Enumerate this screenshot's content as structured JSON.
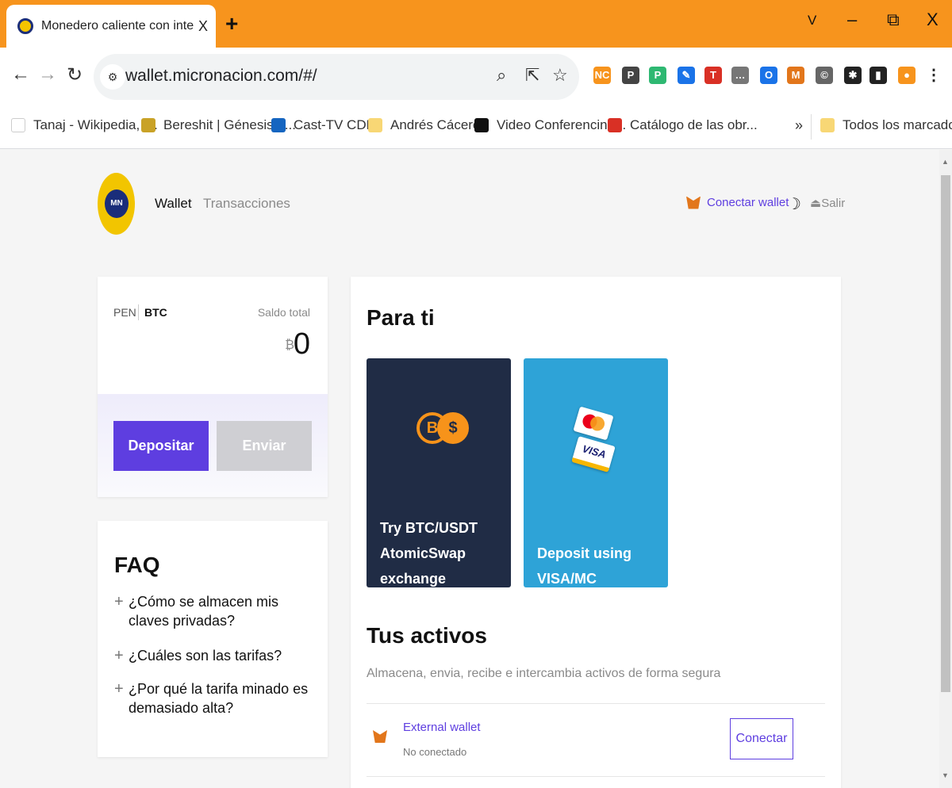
{
  "browser": {
    "tab_title": "Monedero caliente con intercam",
    "tab_close": "X",
    "new_tab": "+",
    "window_controls": {
      "menu": "V",
      "minimize": "–",
      "restore": "⧉",
      "close": "X"
    },
    "url": "wallet.micronacion.com/#/",
    "extensions": [
      {
        "icon": "nc-extension-icon",
        "label": "NC",
        "color": "#f7941d"
      },
      {
        "icon": "circle-p-extension-icon",
        "label": "P",
        "color": "#444444"
      },
      {
        "icon": "green-extension-icon",
        "label": "P",
        "color": "#2eb872"
      },
      {
        "icon": "feather-extension-icon",
        "label": "✎",
        "color": "#1a73e8"
      },
      {
        "icon": "t-extension-icon",
        "label": "T",
        "color": "#d93025"
      },
      {
        "icon": "comment-extension-icon",
        "label": "…",
        "color": "#777777"
      },
      {
        "icon": "blue-circle-extension-icon",
        "label": "O",
        "color": "#1a73e8"
      },
      {
        "icon": "metamask-extension-icon",
        "label": "M",
        "color": "#e2761b"
      },
      {
        "icon": "copyright-extension-icon",
        "label": "©",
        "color": "#666666"
      },
      {
        "icon": "puzzle-extension-icon",
        "label": "✱",
        "color": "#222222"
      },
      {
        "icon": "sidepanel-icon",
        "label": "▮",
        "color": "#222222"
      },
      {
        "icon": "profile-avatar-icon",
        "label": "●",
        "color": "#f7941d"
      },
      {
        "icon": "kebab-menu-icon",
        "label": "⋮",
        "color": "#ffffff"
      }
    ],
    "bookmarks": [
      {
        "label": "Tanaj - Wikipedia, l...",
        "icon_color": "#ffffff",
        "icon": "wikipedia-icon"
      },
      {
        "label": "Bereshit | Génesis –...",
        "icon_color": "#c9a227",
        "icon": "menorah-icon"
      },
      {
        "label": "Cast-TV CDN",
        "icon_color": "#1565c0",
        "icon": "cast-tv-icon"
      },
      {
        "label": "Andrés Cáceres",
        "icon_color": "#f8d775",
        "icon": "folder-icon"
      },
      {
        "label": "Video Conferencing...",
        "icon_color": "#111111",
        "icon": "video-conf-icon"
      },
      {
        "label": "Catálogo de las obr...",
        "icon_color": "#d93025",
        "icon": "catalog-icon"
      }
    ],
    "bookmarks_more": "»",
    "all_bookmarks": "Todos los marcadores"
  },
  "app": {
    "logo_text": "MN",
    "nav": {
      "wallet": "Wallet",
      "transactions": "Transacciones"
    },
    "connect_wallet": "Conectar wallet",
    "theme_toggle": "☽",
    "logout": "Salir",
    "logout_icon": "⏏",
    "balance": {
      "currency_pen": "PEN",
      "currency_btc": "BTC",
      "total_label": "Saldo total",
      "symbol": "₿",
      "value": "0",
      "deposit": "Depositar",
      "send": "Enviar"
    },
    "faq": {
      "title": "FAQ",
      "items": [
        "¿Cómo se almacen mis claves privadas?",
        "¿Cuáles son las tarifas?",
        "¿Por qué la tarifa minado es demasiado alta?"
      ]
    },
    "for_you": {
      "title": "Para ti",
      "tiles": [
        {
          "line1": "Try BTC/USDT",
          "line2": "AtomicSwap exchange",
          "coin1": "B",
          "coin2": "$"
        },
        {
          "line1": "Deposit using VISA/MC",
          "visa": "VISA"
        }
      ]
    },
    "assets": {
      "title": "Tus activos",
      "subtitle": "Almacena, envia, recibe e intercambia activos de forma segura",
      "items": [
        {
          "name": "External wallet",
          "status": "No conectado",
          "action": "Conectar"
        }
      ]
    }
  },
  "colors": {
    "accent": "#5e3ee0",
    "tabbar": "#f7941d",
    "btc_tile": "#202c45",
    "visa_tile": "#2ea3d7"
  }
}
